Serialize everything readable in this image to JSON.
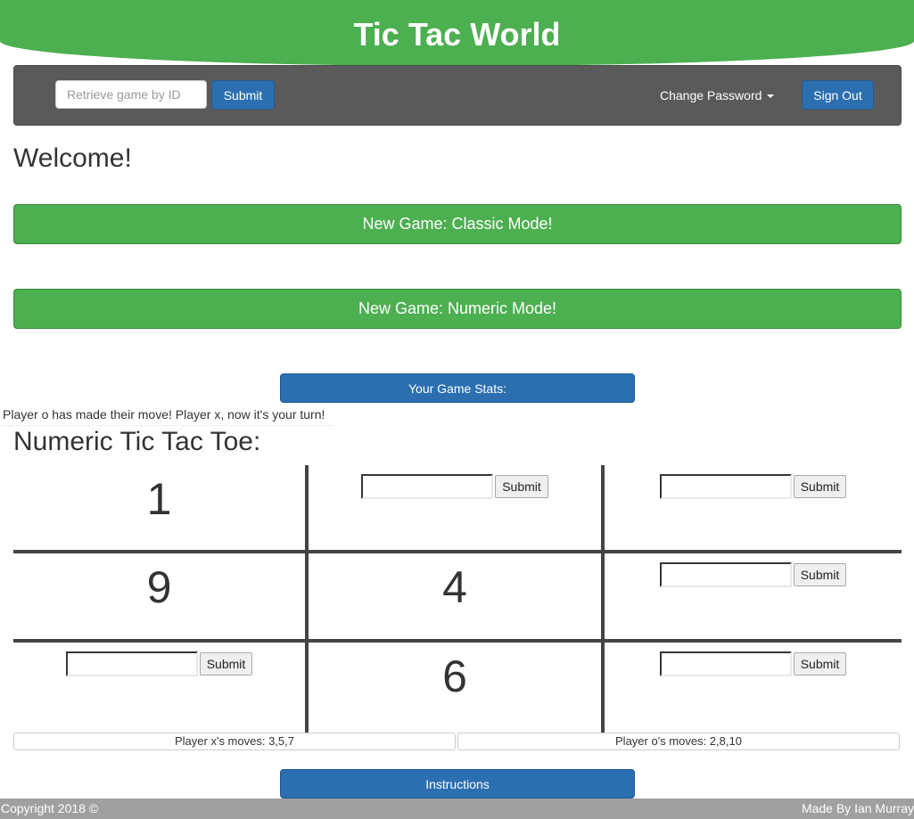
{
  "header": {
    "title": "Tic Tac World"
  },
  "navbar": {
    "search_placeholder": "Retrieve game by ID",
    "search_value": "",
    "submit_label": "Submit",
    "change_password_label": "Change Password",
    "sign_out_label": "Sign Out"
  },
  "main": {
    "welcome": "Welcome!",
    "classic_button": "New Game: Classic Mode!",
    "numeric_button": "New Game: Numeric Mode!",
    "stats_button": "Your Game Stats:",
    "status_message": "Player o has made their move! Player x, now it's your turn!",
    "board_title": "Numeric Tic Tac Toe:"
  },
  "board": {
    "cells": [
      {
        "value": "1",
        "filled": true
      },
      {
        "value": "",
        "filled": false,
        "submit_label": "Submit"
      },
      {
        "value": "",
        "filled": false,
        "submit_label": "Submit"
      },
      {
        "value": "9",
        "filled": true
      },
      {
        "value": "4",
        "filled": true
      },
      {
        "value": "",
        "filled": false,
        "submit_label": "Submit"
      },
      {
        "value": "",
        "filled": false,
        "submit_label": "Submit"
      },
      {
        "value": "6",
        "filled": true
      },
      {
        "value": "",
        "filled": false,
        "submit_label": "Submit"
      }
    ]
  },
  "moves": {
    "player_x": "Player x's moves: 3,5,7",
    "player_o": "Player o's moves: 2,8,10"
  },
  "instructions_button": "Instructions",
  "footer": {
    "copyright": "Copyright 2018 ©",
    "author": "Made By Ian Murray"
  },
  "colors": {
    "brand_green": "#4caf50",
    "primary_blue": "#2b6fb0",
    "navbar_gray": "#5a5a5a",
    "footer_gray": "#a0a0a0"
  }
}
